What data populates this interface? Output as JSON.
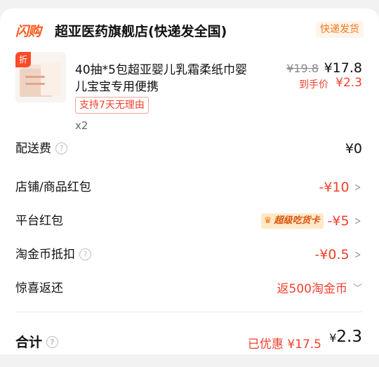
{
  "store": {
    "logo_text": "闪购",
    "name": "超亚医药旗舰店(快递发全国)",
    "shipping_badge": "快递发货"
  },
  "product": {
    "discount_tag": "折",
    "title": "40抽*5包超亚婴儿乳霜柔纸巾婴儿宝宝专用便携",
    "return_policy": "支持7天无理由",
    "quantity": "x2",
    "original_price": "¥19.8",
    "current_price": "¥17.8",
    "final_price_label": "到手价",
    "final_price": "¥2.3"
  },
  "rows": {
    "delivery": {
      "label": "配送费",
      "value": "¥0"
    },
    "store_coupon": {
      "label": "店铺/商品红包",
      "value": "-¥10"
    },
    "platform_coupon": {
      "label": "平台红包",
      "badge": "超级吃货卡",
      "value": "-¥5"
    },
    "coins": {
      "label": "淘金币抵扣",
      "value": "-¥0.5"
    },
    "surprise": {
      "label": "惊喜返还",
      "value": "返500淘金币"
    }
  },
  "total": {
    "label": "合计",
    "saved": "已优惠 ¥17.5",
    "currency": "¥",
    "amount": "2.3"
  },
  "colors": {
    "accent_red": "#f0402e",
    "brand_orange": "#ff5a1f",
    "badge_bg": "#ffe9c7"
  },
  "icons": [
    "help-icon",
    "chevron-right-icon",
    "chevron-down-icon",
    "crown-icon"
  ]
}
